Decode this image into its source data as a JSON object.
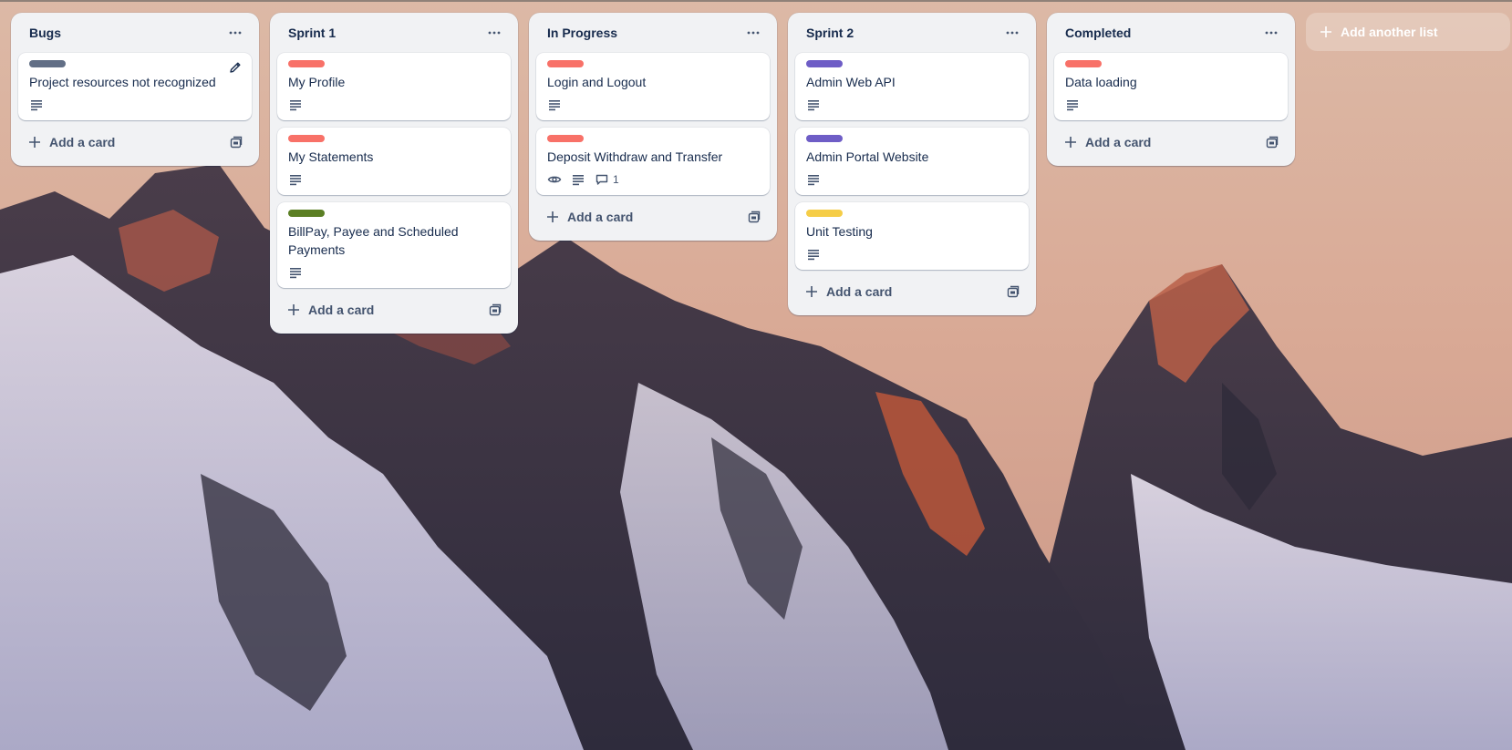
{
  "colors": {
    "red": "#f87168",
    "gray": "#626f86",
    "green": "#5b7f24",
    "purple": "#6e5dc6",
    "yellow": "#f5cd47"
  },
  "board": {
    "lists": [
      {
        "title": "Bugs",
        "cards": [
          {
            "title": "Project resources not recognized",
            "label_color": "#626f86",
            "badges": [
              "description-icon"
            ],
            "show_edit": true
          }
        ],
        "add_card_label": "Add a card"
      },
      {
        "title": "Sprint 1",
        "cards": [
          {
            "title": "My Profile",
            "label_color": "#f87168",
            "badges": [
              "description-icon"
            ]
          },
          {
            "title": "My Statements",
            "label_color": "#f87168",
            "badges": [
              "description-icon"
            ]
          },
          {
            "title": "BillPay, Payee and Scheduled Payments",
            "label_color": "#5b7f24",
            "badges": [
              "description-icon"
            ]
          }
        ],
        "add_card_label": "Add a card"
      },
      {
        "title": "In Progress",
        "cards": [
          {
            "title": "Login and Logout",
            "label_color": "#f87168",
            "badges": [
              "description-icon"
            ]
          },
          {
            "title": "Deposit Withdraw and Transfer",
            "label_color": "#f87168",
            "badges": [
              "watch-icon",
              "description-icon"
            ],
            "comments": "1"
          }
        ],
        "add_card_label": "Add a card"
      },
      {
        "title": "Sprint 2",
        "cards": [
          {
            "title": "Admin Web API",
            "label_color": "#6e5dc6",
            "badges": [
              "description-icon"
            ]
          },
          {
            "title": "Admin Portal Website",
            "label_color": "#6e5dc6",
            "badges": [
              "description-icon"
            ]
          },
          {
            "title": "Unit Testing",
            "label_color": "#f5cd47",
            "badges": [
              "description-icon"
            ]
          }
        ],
        "add_card_label": "Add a card"
      },
      {
        "title": "Completed",
        "cards": [
          {
            "title": "Data loading",
            "label_color": "#f87168",
            "badges": [
              "description-icon"
            ]
          }
        ],
        "add_card_label": "Add a card"
      }
    ],
    "add_list_label": "Add another list"
  }
}
